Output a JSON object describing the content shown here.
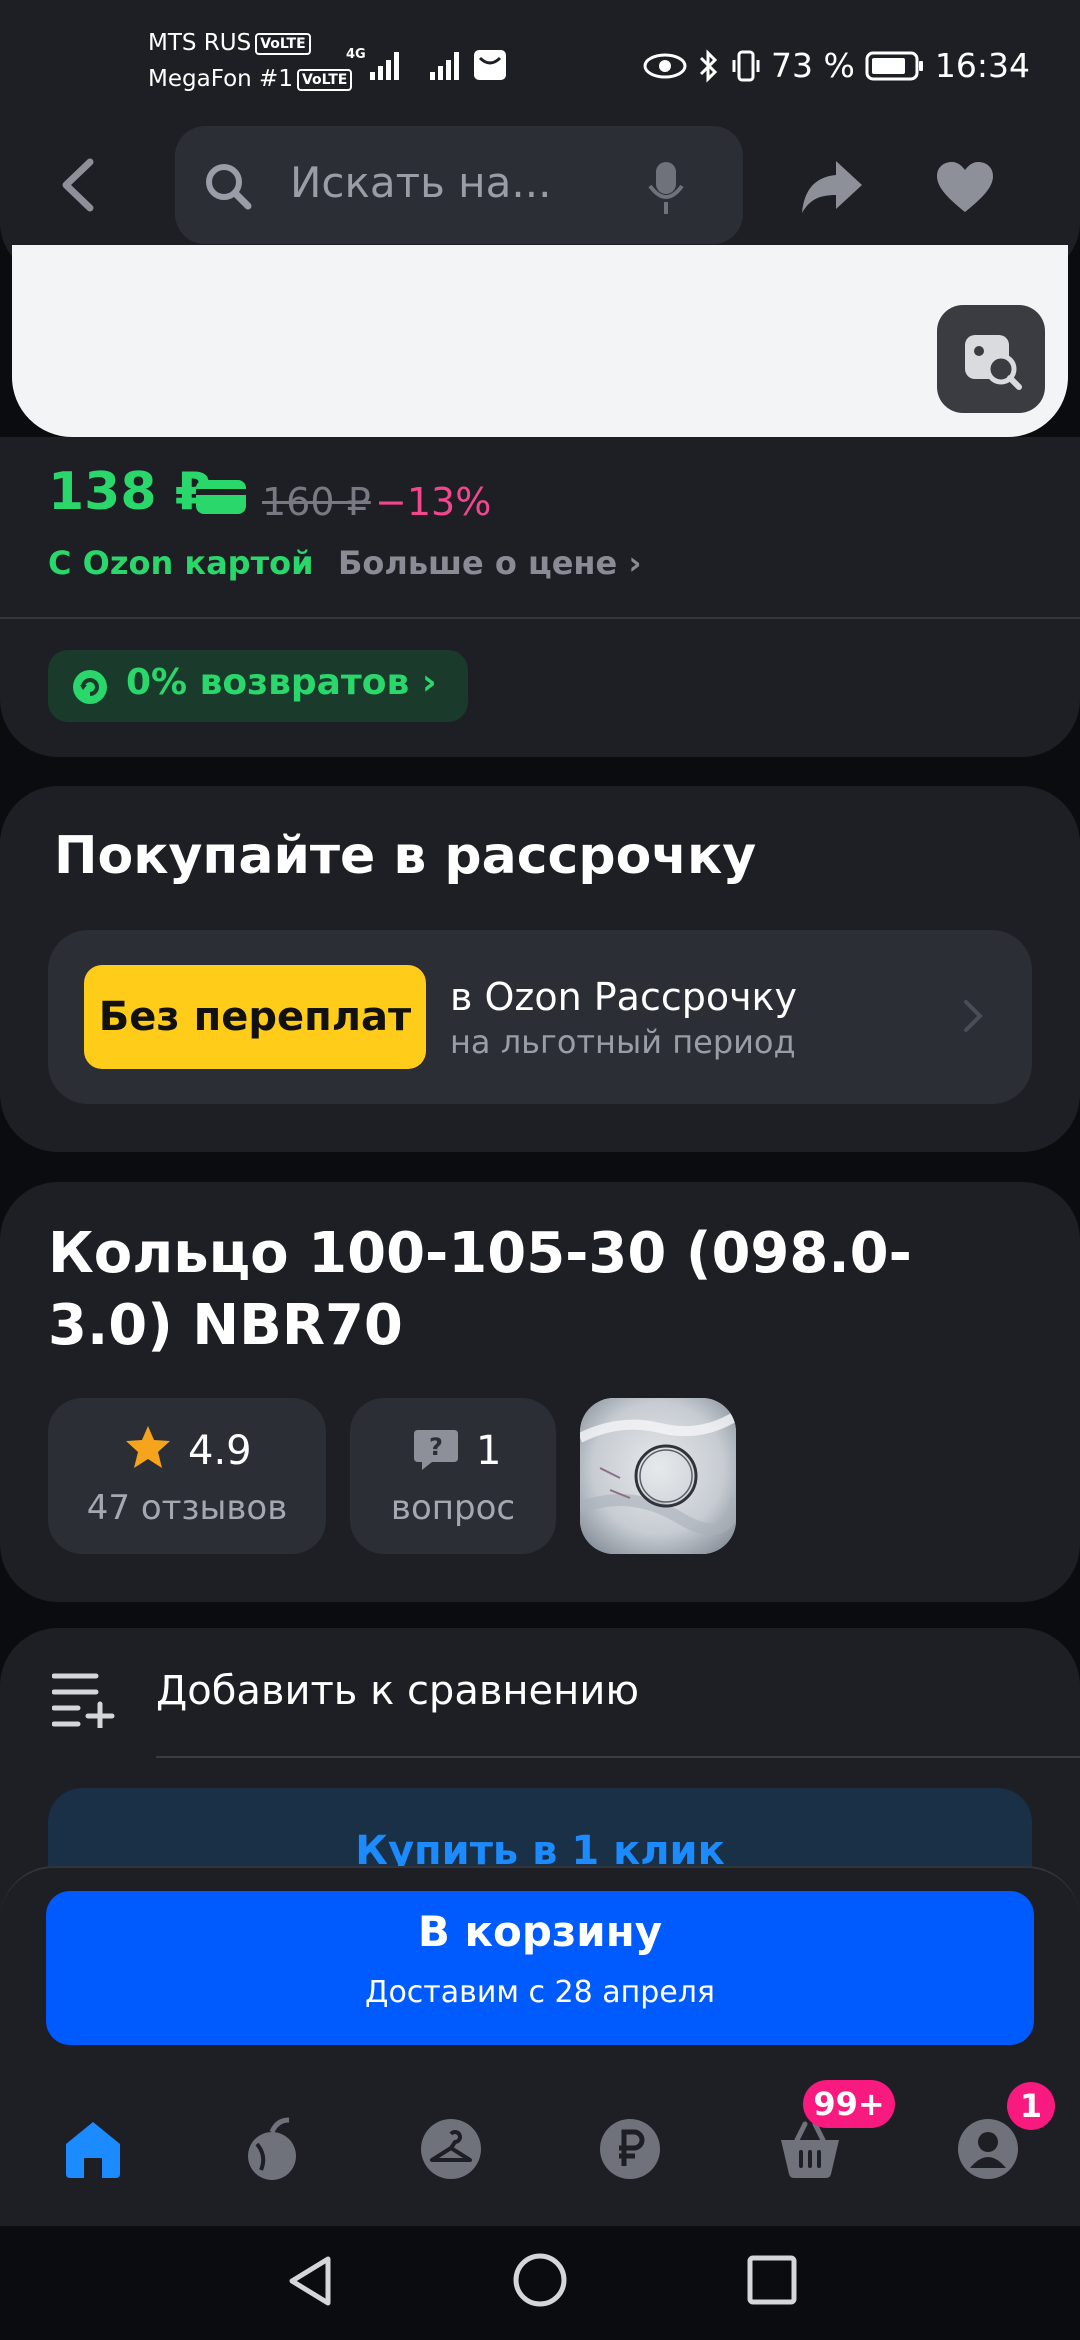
{
  "status_bar": {
    "carrier1": "MTS RUS",
    "carrier2": "MegaFon #1",
    "volte": "VoLTE",
    "network": "4G",
    "battery": "73 %",
    "time": "16:34"
  },
  "header": {
    "search_placeholder": "Искать на..."
  },
  "price": {
    "current": "138 ₽",
    "old": "160 ₽",
    "discount": "−13%",
    "ozon_card_label": "С Ozon картой",
    "more_label": "Больше о цене",
    "returns_label": "0% возвратов"
  },
  "installment": {
    "title": "Покупайте в рассрочку",
    "badge": "Без переплат",
    "line1": "в Ozon Рассрочку",
    "line2": "на льготный период"
  },
  "product": {
    "title": "Кольцо 100-105-30 (098.0-3.0) NBR70",
    "rating": "4.9",
    "reviews": "47 отзывов",
    "questions_count": "1",
    "questions_label": "вопрос"
  },
  "actions": {
    "compare": "Добавить к сравнению",
    "buy_one_click": "Купить в 1 клик"
  },
  "cart": {
    "button": "В корзину",
    "delivery": "Доставим с 28 апреля"
  },
  "bottom_nav": {
    "items": [
      "home-icon",
      "fresh-icon",
      "catalog-icon",
      "finance-icon",
      "cart-icon",
      "profile-icon"
    ],
    "cart_badge": "99+",
    "profile_badge": "1"
  },
  "colors": {
    "green": "#2ad76b",
    "pink": "#f2468e",
    "blue": "#005bff",
    "yellow": "#ffcc1a"
  }
}
